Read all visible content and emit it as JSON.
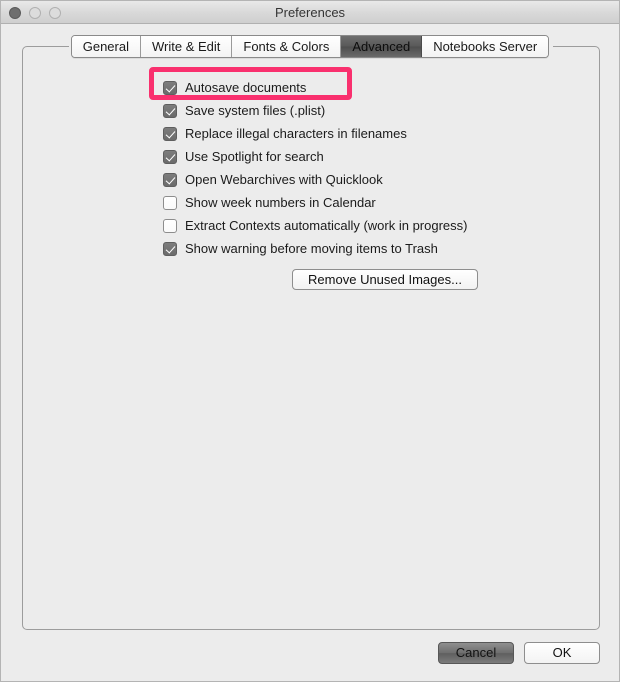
{
  "window": {
    "title": "Preferences",
    "traffic_lights": [
      {
        "name": "close-button",
        "label": "Close"
      },
      {
        "name": "minimize-button",
        "label": "Minimize"
      },
      {
        "name": "maximize-button",
        "label": "Maximize"
      }
    ]
  },
  "tabs": [
    {
      "label": "General",
      "selected": false
    },
    {
      "label": "Write & Edit",
      "selected": false
    },
    {
      "label": "Fonts & Colors",
      "selected": false
    },
    {
      "label": "Advanced",
      "selected": true
    },
    {
      "label": "Notebooks Server",
      "selected": false
    }
  ],
  "advanced": {
    "checkboxes": [
      {
        "label": "Autosave documents",
        "checked": true,
        "highlighted": true
      },
      {
        "label": "Save system files (.plist)",
        "checked": true,
        "highlighted": false
      },
      {
        "label": "Replace illegal characters in filenames",
        "checked": true,
        "highlighted": false
      },
      {
        "label": "Use Spotlight for search",
        "checked": true,
        "highlighted": false
      },
      {
        "label": "Open Webarchives with Quicklook",
        "checked": true,
        "highlighted": false
      },
      {
        "label": "Show week numbers in Calendar",
        "checked": false,
        "highlighted": false
      },
      {
        "label": "Extract Contexts automatically (work in progress)",
        "checked": false,
        "highlighted": false
      },
      {
        "label": "Show warning before moving items to Trash",
        "checked": true,
        "highlighted": false
      }
    ],
    "remove_button_label": "Remove Unused Images..."
  },
  "footer": {
    "cancel_label": "Cancel",
    "ok_label": "OK"
  },
  "annotation": {
    "color": "#f9306e",
    "target": "Autosave documents"
  }
}
